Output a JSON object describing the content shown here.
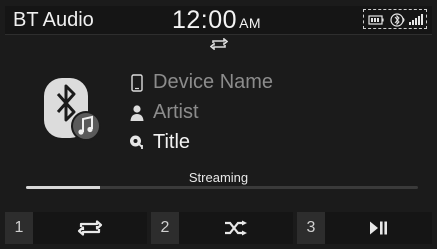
{
  "status_bar": {
    "title": "BT Audio",
    "time": "12:00",
    "ampm": "AM",
    "icons": [
      "battery-icon",
      "bluetooth-icon",
      "signal-icon"
    ]
  },
  "now_playing": {
    "repeat_indicator_icon": "repeat-icon",
    "source_icon": "bluetooth-music-icon",
    "device_name": "Device Name",
    "artist": "Artist",
    "title": "Title",
    "status": "Streaming",
    "progress": 0.19
  },
  "softkeys": [
    {
      "number": "1",
      "icon": "repeat-icon"
    },
    {
      "number": "2",
      "icon": "shuffle-icon"
    },
    {
      "number": "3",
      "icon": "play-pause-icon"
    }
  ],
  "colors": {
    "background": "#1b1b1b",
    "text_primary": "#f2f2f2",
    "text_dim": "#8c8c8c",
    "key_number_bg": "#2d2d2d"
  }
}
